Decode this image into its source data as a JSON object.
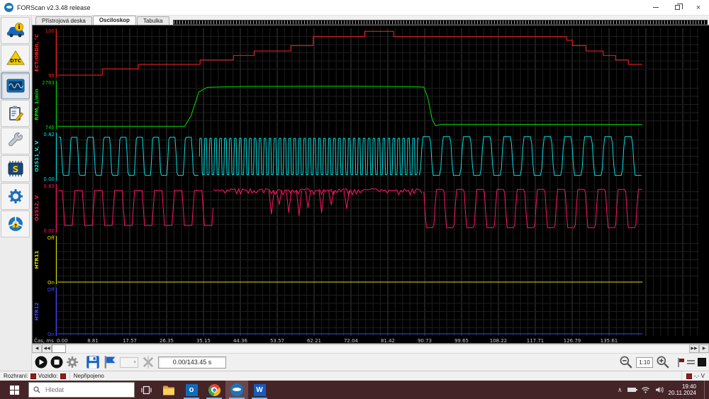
{
  "titlebar": {
    "title": "FORScan v2.3.48 release"
  },
  "tabs": {
    "items": [
      {
        "label": "Přístrojová deska",
        "active": false
      },
      {
        "label": "Osciloskop",
        "active": true
      },
      {
        "label": "Tabulka",
        "active": false
      }
    ]
  },
  "sidebar": {
    "dtc_label": "DTC",
    "chip_label": "S",
    "help_label": "?",
    "info_label": "i",
    "items": [
      {
        "id": "vehicle-info",
        "icon": "car-info-icon"
      },
      {
        "id": "dtc",
        "icon": "dtc-triangle-icon"
      },
      {
        "id": "oscilloscope",
        "icon": "oscilloscope-icon",
        "active": true
      },
      {
        "id": "tests",
        "icon": "clipboard-icon"
      },
      {
        "id": "service",
        "icon": "wrench-icon"
      },
      {
        "id": "programming",
        "icon": "chip-icon"
      },
      {
        "id": "settings",
        "icon": "gear-icon"
      },
      {
        "id": "about",
        "icon": "steering-wheel-help-icon"
      }
    ]
  },
  "transport": {
    "time_display": "0.00/143.45 s",
    "zoom_ratio": "1:10"
  },
  "statusbar": {
    "interface_label": "Rozhraní:",
    "vehicle_label": "Vozidlo:",
    "status": "Nepřipojeno",
    "voltage": "-.- V"
  },
  "taskbar": {
    "search_placeholder": "Hledat",
    "clock_time": "19:40",
    "clock_date": "20.11.2024"
  },
  "chart_data": {
    "type": "line",
    "title": "Osciloskop",
    "xlabel": "Čas, ms",
    "x_ticks": [
      "0.00",
      "8.81",
      "17.57",
      "26.35",
      "35.15",
      "44.36",
      "53.57",
      "62.21",
      "72.04",
      "81.42",
      "90.73",
      "99.65",
      "108.22",
      "117.71",
      "126.79",
      "135.61"
    ],
    "grid": true,
    "background": "#000000",
    "data_end_x": 0.912,
    "channels": [
      {
        "name": "ECT/OBDII, °C",
        "color": "#ff2020",
        "max": "100",
        "min": "95",
        "ymin": 95,
        "ymax": 100,
        "segments": [
          {
            "type": "steps",
            "points": [
              [
                0.002,
                95.0
              ],
              [
                0.072,
                95.7
              ],
              [
                0.128,
                96.2
              ],
              [
                0.224,
                96.7
              ],
              [
                0.276,
                97.2
              ],
              [
                0.308,
                97.7
              ],
              [
                0.365,
                98.3
              ],
              [
                0.4,
                99.3
              ],
              [
                0.48,
                99.9
              ],
              [
                0.525,
                99.3
              ],
              [
                0.794,
                98.9
              ],
              [
                0.803,
                98.3
              ],
              [
                0.824,
                97.7
              ],
              [
                0.851,
                97.2
              ],
              [
                0.87,
                96.7
              ],
              [
                0.89,
                96.2
              ],
              [
                0.912,
                96.2
              ]
            ]
          }
        ]
      },
      {
        "name": "RPM, 1/min",
        "color": "#00dd00",
        "max": "2763",
        "min": "745",
        "ymin": 745,
        "ymax": 2763,
        "segments": [
          {
            "type": "line",
            "points": [
              [
                0.002,
                770
              ],
              [
                0.2,
                770
              ],
              [
                0.21,
                1250
              ],
              [
                0.222,
                2320
              ],
              [
                0.235,
                2530
              ],
              [
                0.3,
                2575
              ],
              [
                0.45,
                2585
              ],
              [
                0.55,
                2560
              ],
              [
                0.572,
                2540
              ],
              [
                0.578,
                2080
              ],
              [
                0.585,
                1080
              ],
              [
                0.59,
                800
              ],
              [
                0.6,
                860
              ],
              [
                0.912,
                850
              ]
            ]
          }
        ]
      },
      {
        "name": "O2S11_V, V",
        "color": "#00e0e0",
        "max": "0.82",
        "min": "0.00",
        "ymin": 0,
        "ymax": 0.82,
        "segments": [
          {
            "type": "wave",
            "x0": 0.004,
            "x1": 0.223,
            "period": 0.0254,
            "high": 0.76,
            "low": 0.06,
            "phase": 0.3
          },
          {
            "type": "wave",
            "x0": 0.223,
            "x1": 0.565,
            "period": 0.0077,
            "high": 0.74,
            "low": 0.07,
            "phase": 0.0
          },
          {
            "type": "wave",
            "x0": 0.565,
            "x1": 0.912,
            "period": 0.0314,
            "high": 0.77,
            "low": 0.06,
            "phase": 0.9
          }
        ]
      },
      {
        "name": "O2S12, V",
        "color": "#ff1464",
        "max": "0.83",
        "min": "0.00",
        "ymin": 0,
        "ymax": 0.83,
        "segments": [
          {
            "type": "wave",
            "x0": 0.004,
            "x1": 0.245,
            "period": 0.031,
            "high": 0.74,
            "low": 0.09,
            "phase": 0.25
          },
          {
            "type": "noisy",
            "x0": 0.245,
            "x1": 0.572,
            "high": 0.79,
            "jitter": 0.12,
            "step": 0.003,
            "dips": [
              [
                0.335,
                0.3
              ],
              [
                0.347,
                0.48
              ],
              [
                0.362,
                0.33
              ],
              [
                0.378,
                0.27
              ],
              [
                0.392,
                0.42
              ],
              [
                0.413,
                0.33
              ],
              [
                0.428,
                0.47
              ],
              [
                0.452,
                0.4
              ]
            ]
          },
          {
            "type": "wave",
            "x0": 0.572,
            "x1": 0.912,
            "period": 0.0314,
            "high": 0.76,
            "low": 0.05,
            "phase": 0.45
          }
        ]
      },
      {
        "name": "HTR11",
        "color": "#e0e000",
        "max": "Off",
        "min": "On",
        "ymin": 0,
        "ymax": 1,
        "segments": [
          {
            "type": "line",
            "points": [
              [
                0.002,
                0
              ],
              [
                0.912,
                0
              ]
            ]
          }
        ]
      },
      {
        "name": "HTR12",
        "color": "#4646ff",
        "max": "Off",
        "min": "On",
        "ymin": 0,
        "ymax": 1,
        "segments": [
          {
            "type": "line",
            "points": [
              [
                0.002,
                0
              ],
              [
                0.912,
                0
              ]
            ]
          }
        ]
      }
    ]
  }
}
